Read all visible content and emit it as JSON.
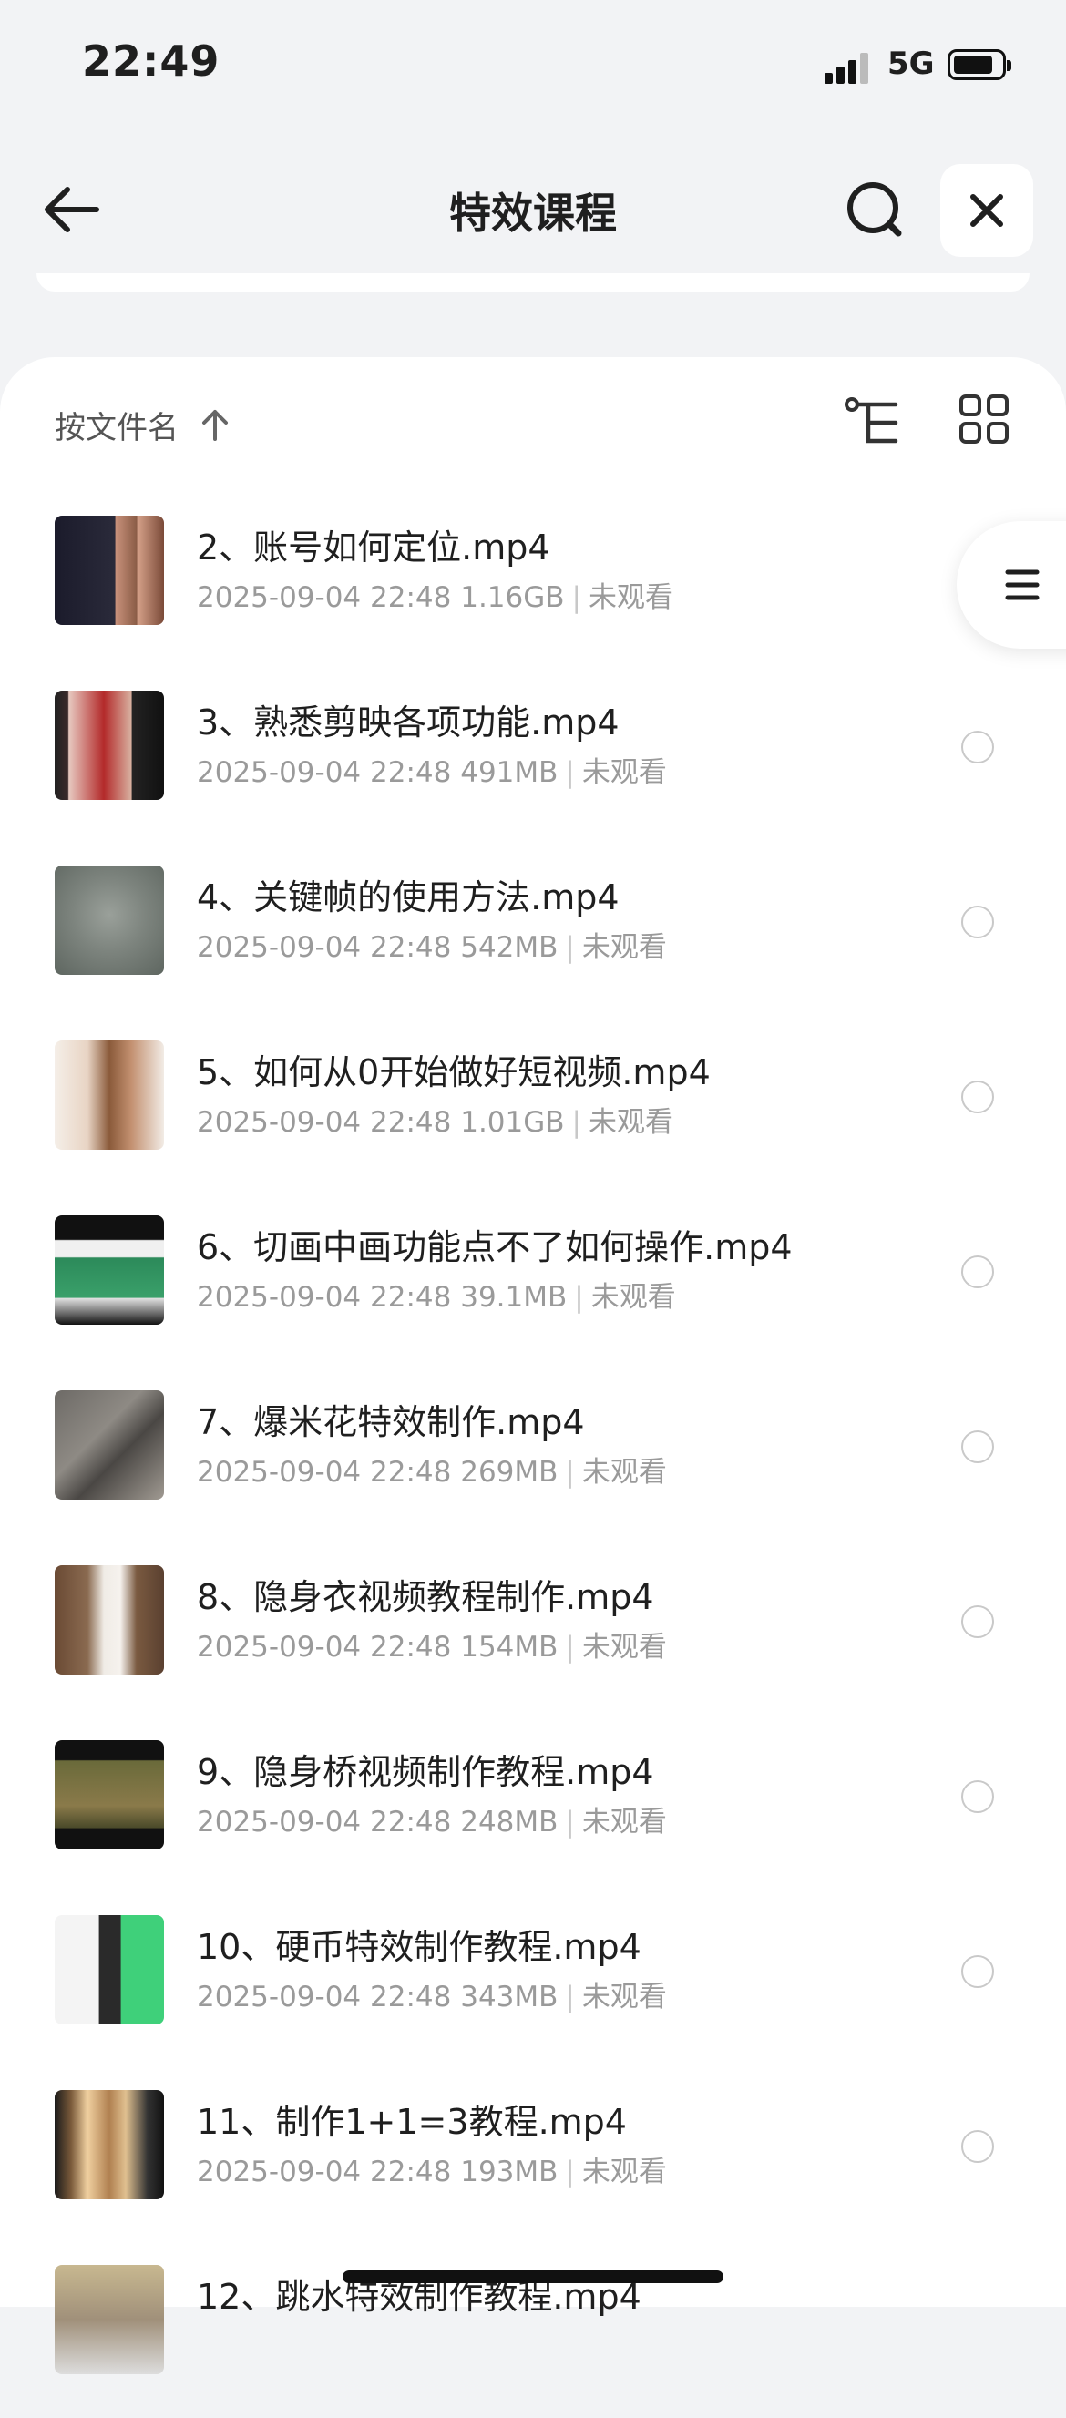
{
  "status_bar": {
    "time": "22:49",
    "network": "5G"
  },
  "header": {
    "title": "特效课程"
  },
  "sort": {
    "label": "按文件名"
  },
  "files": [
    {
      "name": "2、账号如何定位.mp4",
      "date": "2025-09-04 22:48",
      "size": "1.16GB",
      "status": "未观看",
      "thumb": "t1"
    },
    {
      "name": "3、熟悉剪映各项功能.mp4",
      "date": "2025-09-04 22:48",
      "size": "491MB",
      "status": "未观看",
      "thumb": "t2"
    },
    {
      "name": "4、关键帧的使用方法.mp4",
      "date": "2025-09-04 22:48",
      "size": "542MB",
      "status": "未观看",
      "thumb": "t3"
    },
    {
      "name": "5、如何从0开始做好短视频.mp4",
      "date": "2025-09-04 22:48",
      "size": "1.01GB",
      "status": "未观看",
      "thumb": "t4"
    },
    {
      "name": "6、切画中画功能点不了如何操作.mp4",
      "date": "2025-09-04 22:48",
      "size": "39.1MB",
      "status": "未观看",
      "thumb": "t5"
    },
    {
      "name": "7、爆米花特效制作.mp4",
      "date": "2025-09-04 22:48",
      "size": "269MB",
      "status": "未观看",
      "thumb": "t6"
    },
    {
      "name": "8、隐身衣视频教程制作.mp4",
      "date": "2025-09-04 22:48",
      "size": "154MB",
      "status": "未观看",
      "thumb": "t7"
    },
    {
      "name": "9、隐身桥视频制作教程.mp4",
      "date": "2025-09-04 22:48",
      "size": "248MB",
      "status": "未观看",
      "thumb": "t8"
    },
    {
      "name": "10、硬币特效制作教程.mp4",
      "date": "2025-09-04 22:48",
      "size": "343MB",
      "status": "未观看",
      "thumb": "t9"
    },
    {
      "name": "11、制作1+1=3教程.mp4",
      "date": "2025-09-04 22:48",
      "size": "193MB",
      "status": "未观看",
      "thumb": "t10"
    },
    {
      "name": "12、跳水特效制作教程.mp4",
      "date": "",
      "size": "",
      "status": "",
      "thumb": "t11"
    }
  ],
  "icons": {
    "back": "arrow-left-icon",
    "search": "search-icon",
    "close": "close-icon",
    "sort": "arrow-up-icon",
    "tree": "tree-view-icon",
    "grid": "grid-view-icon",
    "menu": "menu-icon"
  }
}
